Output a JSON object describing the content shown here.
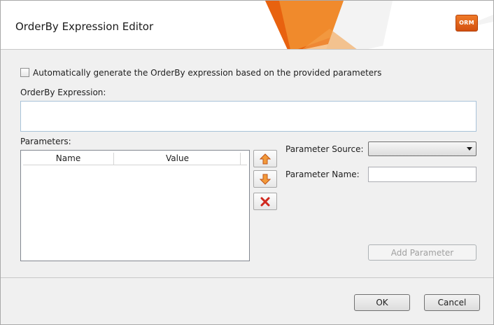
{
  "window": {
    "title": "OrderBy Expression Editor",
    "logo_text": "ORM",
    "accent_color": "#e8620f"
  },
  "form": {
    "auto_generate_label": "Automatically generate the OrderBy expression based on the provided parameters",
    "auto_generate_checked": false,
    "expression_label": "OrderBy Expression:",
    "expression_value": "",
    "parameters_label": "Parameters:",
    "grid_columns": [
      "Name",
      "Value"
    ],
    "grid_rows": [],
    "move_up_icon": "arrow-up-icon",
    "move_down_icon": "arrow-down-icon",
    "delete_icon": "delete-x-icon",
    "parameter_source_label": "Parameter Source:",
    "parameter_source_value": "",
    "parameter_name_label": "Parameter Name:",
    "parameter_name_value": "",
    "add_parameter_label": "Add Parameter"
  },
  "footer": {
    "ok_label": "OK",
    "cancel_label": "Cancel"
  }
}
